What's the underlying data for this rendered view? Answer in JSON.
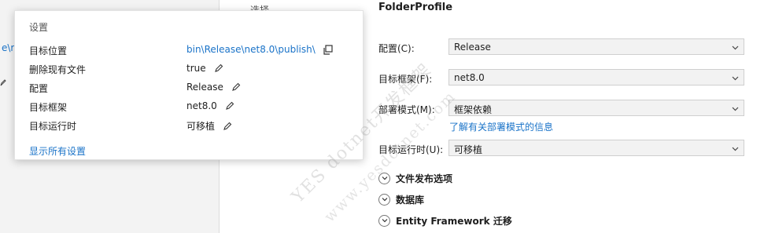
{
  "background": {
    "top_label": "选择",
    "left_link_fragment": "e\\r"
  },
  "popup": {
    "title": "设置",
    "rows": [
      {
        "label": "目标位置",
        "value": "bin\\Release\\net8.0\\publish\\"
      },
      {
        "label": "删除现有文件",
        "value": "true"
      },
      {
        "label": "配置",
        "value": "Release"
      },
      {
        "label": "目标框架",
        "value": "net8.0"
      },
      {
        "label": "目标运行时",
        "value": "可移植"
      }
    ],
    "show_all": "显示所有设置"
  },
  "profile": {
    "title": "FolderProfile",
    "configuration": {
      "label": "配置(C):",
      "value": "Release"
    },
    "target_framework": {
      "label": "目标框架(F):",
      "value": "net8.0"
    },
    "deployment_mode": {
      "label": "部署模式(M):",
      "value": "框架依赖"
    },
    "deployment_info_link": "了解有关部署模式的信息",
    "target_runtime": {
      "label": "目标运行时(U):",
      "value": "可移植"
    }
  },
  "sections": [
    {
      "label": "文件发布选项"
    },
    {
      "label": "数据库"
    },
    {
      "label": "Entity Framework 迁移"
    }
  ],
  "watermark": {
    "line1": "YES dotnet开发框架",
    "line2": "www.yesdotnet.com"
  },
  "icons": {
    "copy": "copy-icon",
    "edit": "pencil-icon",
    "dropdown": "chevron-down-icon",
    "expand": "expand-chevron-icon"
  },
  "colors": {
    "link": "#1a73c8",
    "combo_bg": "#f2f2f2",
    "left_panel_bg": "#f3f3f3"
  }
}
